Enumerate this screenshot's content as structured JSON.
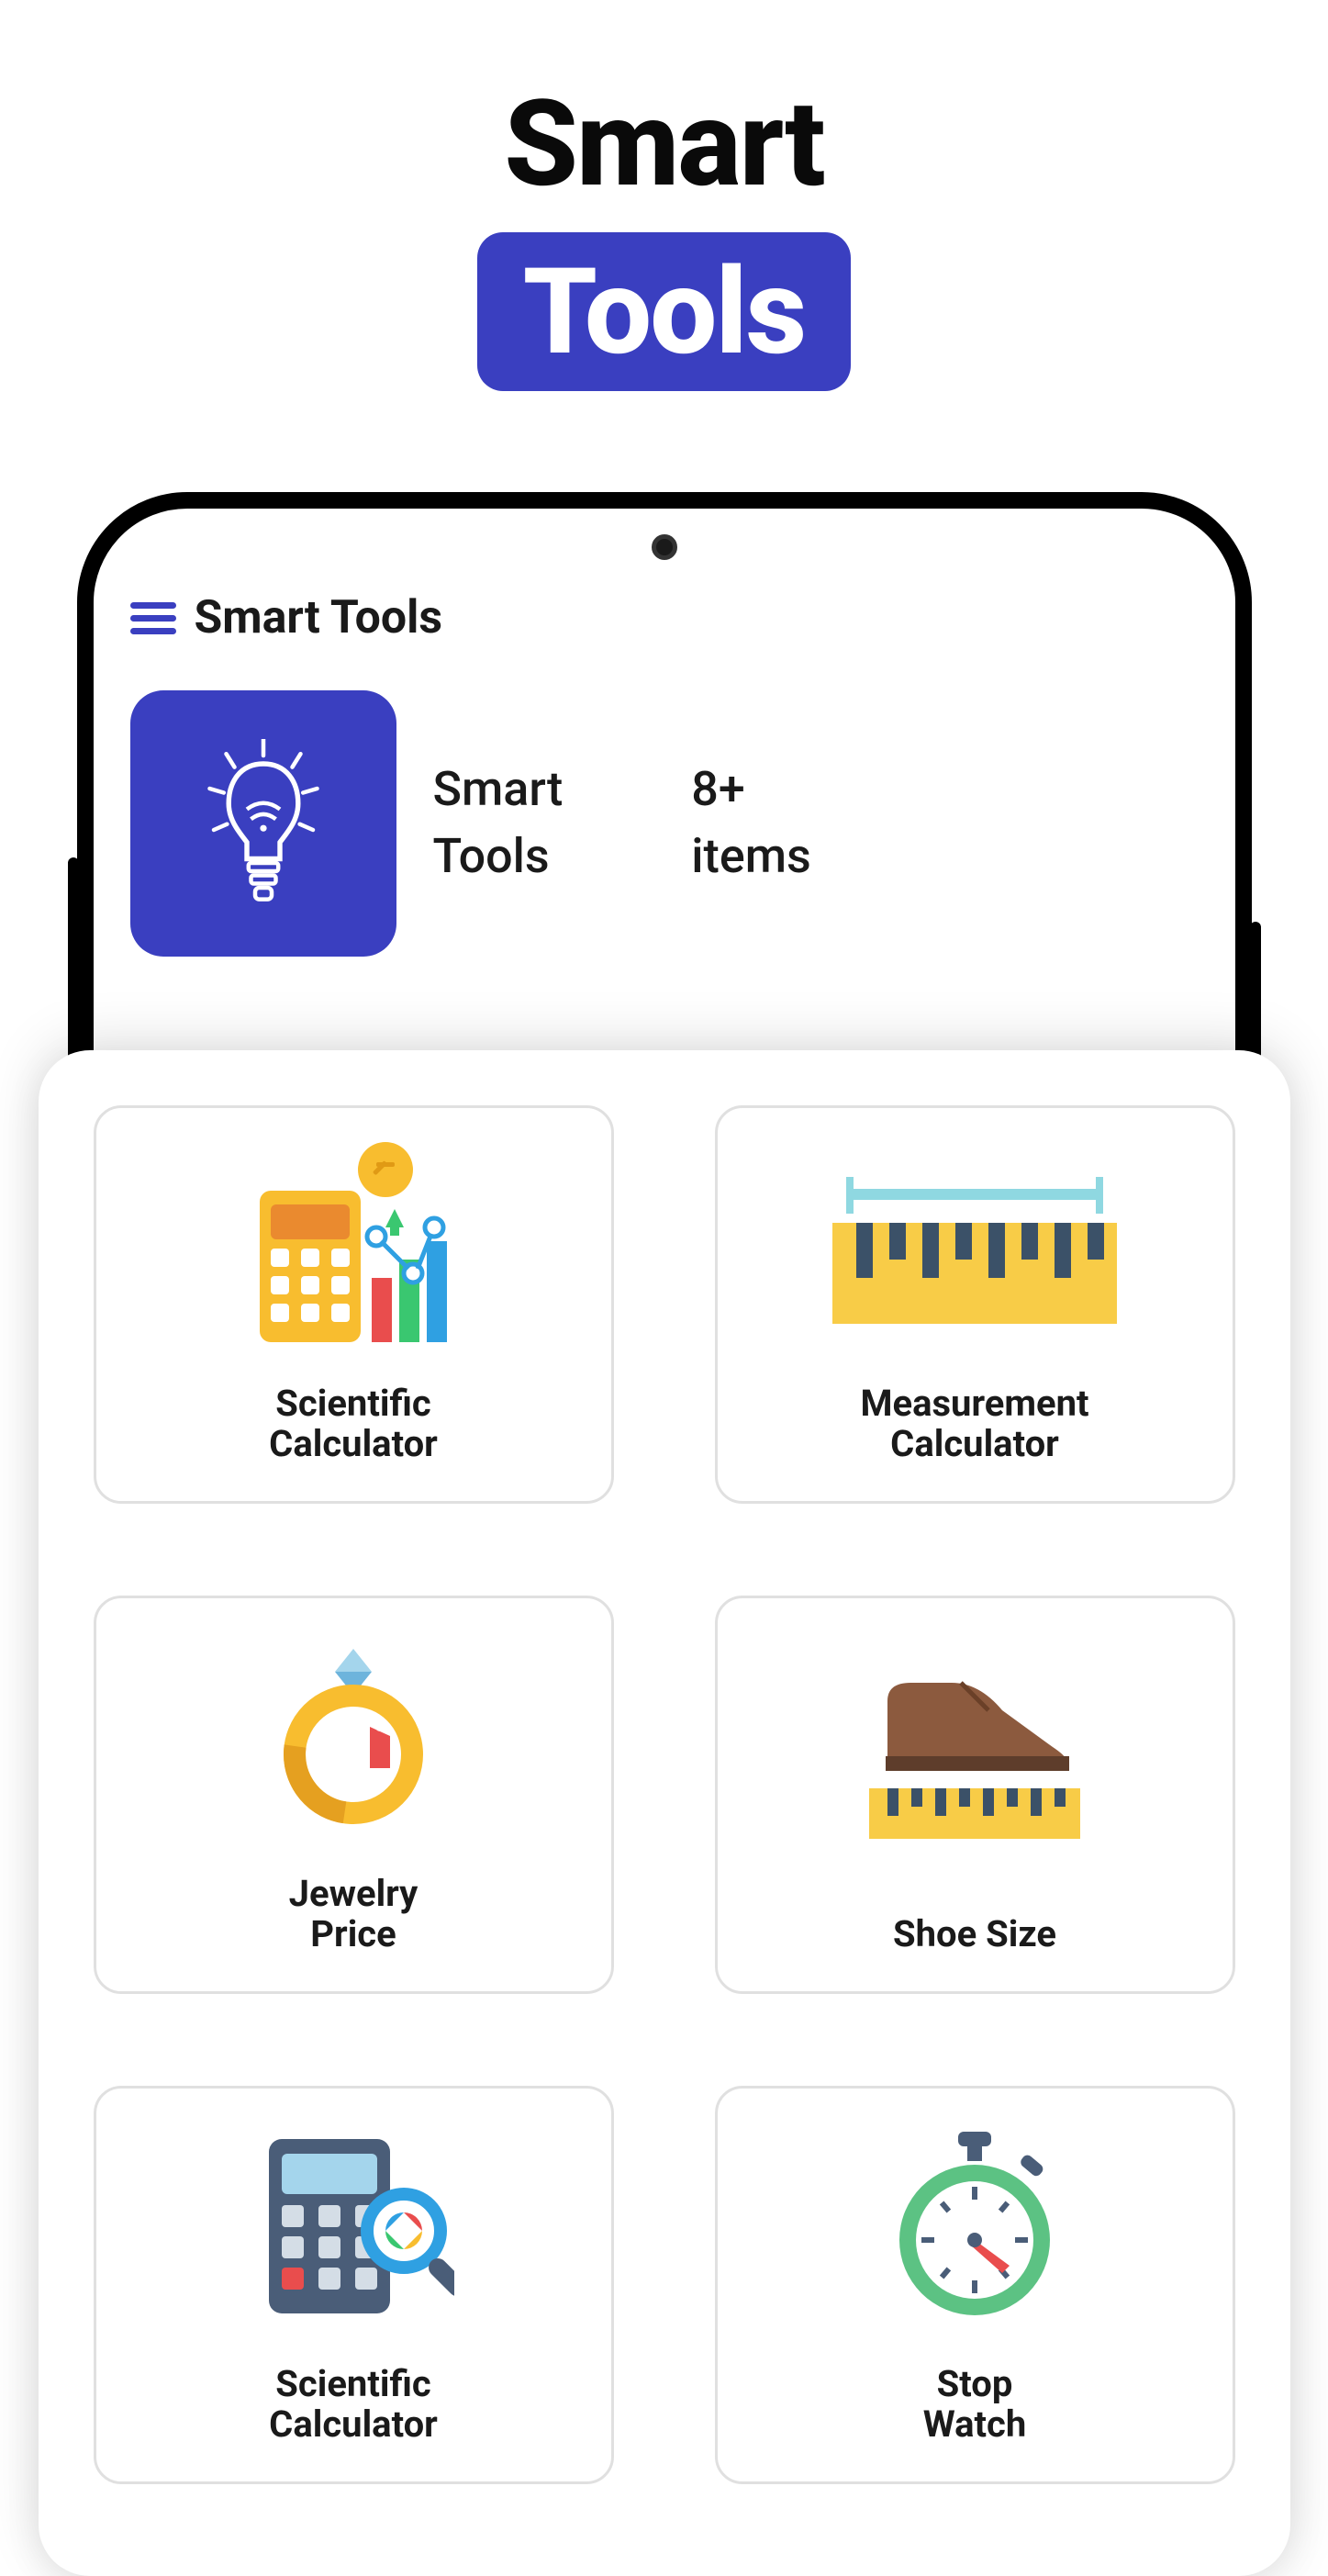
{
  "page": {
    "title_line1": "Smart",
    "title_line2": "Tools"
  },
  "app": {
    "header_title": "Smart Tools",
    "category": {
      "name": "Smart\nTools",
      "count": "8+\nitems"
    }
  },
  "tools": [
    {
      "label": "Scientific\nCalculator",
      "icon": "scientific-calculator-icon"
    },
    {
      "label": "Measurement\nCalculator",
      "icon": "ruler-icon"
    },
    {
      "label": "Jewelry\nPrice",
      "icon": "ring-icon"
    },
    {
      "label": "Shoe Size",
      "icon": "shoe-icon"
    },
    {
      "label": "Scientific\nCalculator",
      "icon": "calculator-magnifier-icon"
    },
    {
      "label": "Stop\nWatch",
      "icon": "stopwatch-icon"
    }
  ],
  "colors": {
    "accent": "#3a3fc0"
  }
}
